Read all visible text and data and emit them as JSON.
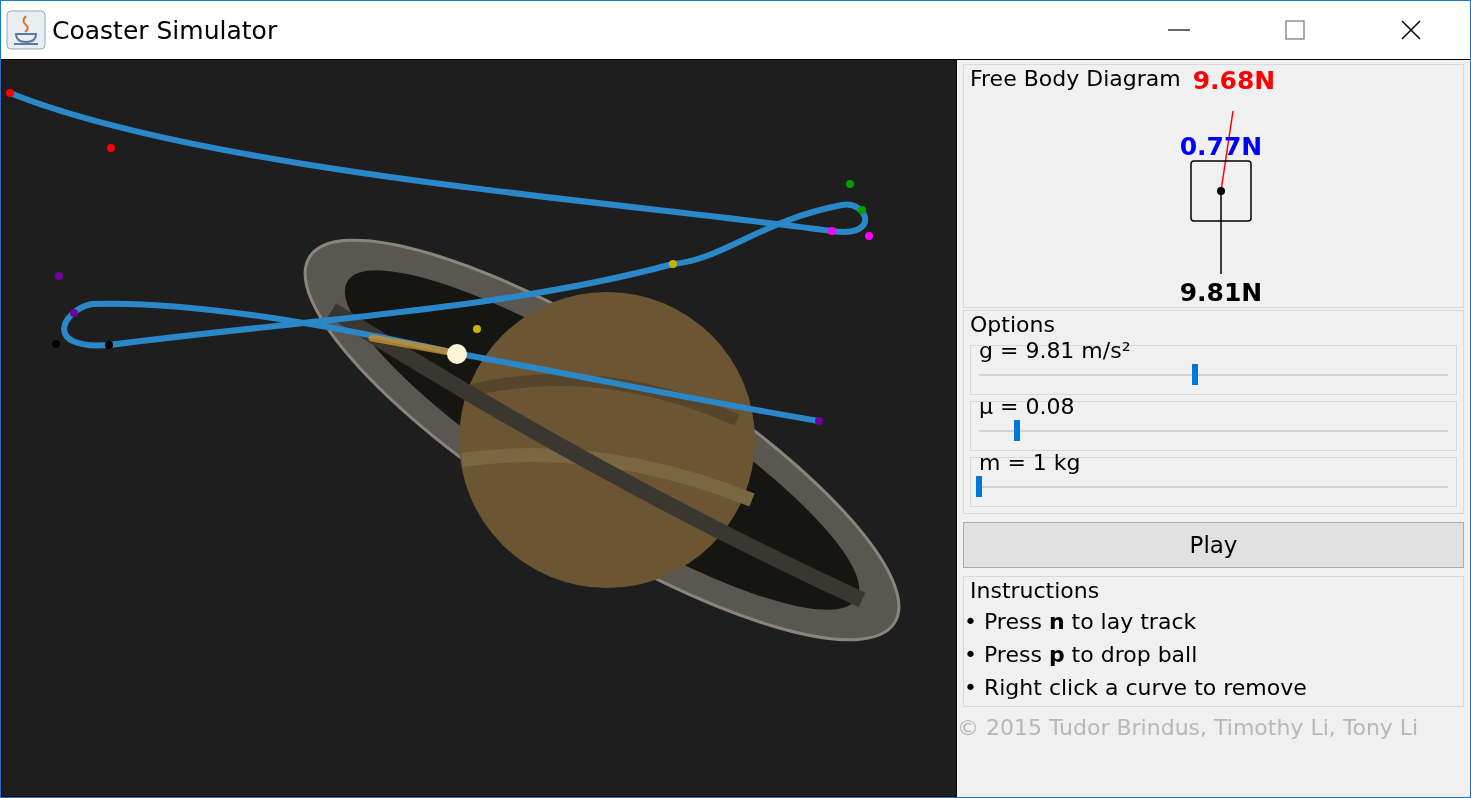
{
  "window": {
    "title": "Coaster Simulator"
  },
  "free_body_diagram": {
    "title": "Free Body Diagram",
    "normal_force": "9.68N",
    "friction_force": "0.77N",
    "gravity_force": "9.81N"
  },
  "options": {
    "title": "Options",
    "sliders": [
      {
        "label": "g = 9.81 m/s²",
        "level": 0.46
      },
      {
        "label": "μ = 0.08",
        "level": 0.08
      },
      {
        "label": "m = 1 kg",
        "level": 0
      }
    ]
  },
  "play_button": "Play",
  "instructions": {
    "title": "Instructions",
    "items": [
      "• Press **n** to lay track",
      "• Press **p** to drop ball",
      "• Right click a curve to remove"
    ]
  },
  "footer": "© 2015 Tudor Brindus, Timothy Li, Tony Li"
}
